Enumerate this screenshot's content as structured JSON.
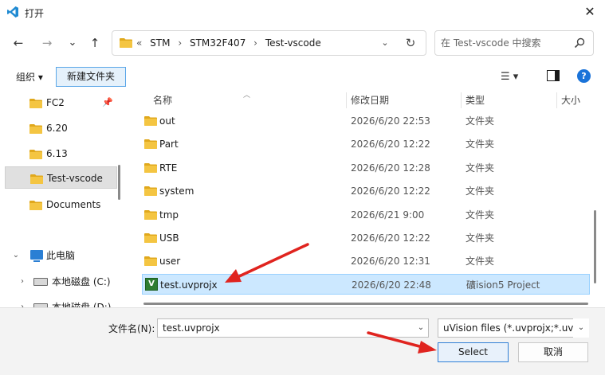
{
  "window": {
    "title": "打开",
    "close_glyph": "✕"
  },
  "nav": {
    "back_glyph": "←",
    "forward_glyph": "→",
    "recent_glyph": "⌄",
    "up_glyph": "↑",
    "breadcrumb_lead": "«",
    "breadcrumbs": [
      "STM",
      "STM32F407",
      "Test-vscode"
    ],
    "breadcrumb_sep": "›",
    "dropdown_glyph": "⌄",
    "refresh_glyph": "↻",
    "search_placeholder": "在 Test-vscode 中搜索"
  },
  "toolbar": {
    "organize_label": "组织 ▾",
    "new_folder_label": "新建文件夹",
    "view_glyph": "☰ ▾",
    "help_glyph": "?"
  },
  "sidebar": {
    "pin_glyph": "📌",
    "items": [
      {
        "label": "FC2",
        "pinned": true
      },
      {
        "label": "6.20"
      },
      {
        "label": "6.13"
      },
      {
        "label": "Test-vscode",
        "selected": true
      },
      {
        "label": "Documents"
      }
    ],
    "this_pc": {
      "label": "此电脑",
      "expander": "⌄"
    },
    "drives": [
      {
        "label": "本地磁盘 (C:)",
        "expander": "›"
      },
      {
        "label": "本地磁盘 (D:)",
        "expander": "›"
      }
    ]
  },
  "columns": {
    "name": "名称",
    "date": "修改日期",
    "type": "类型",
    "size": "大小",
    "sort_glyph": "︿"
  },
  "files": [
    {
      "name": "out",
      "date": "2026/6/20 22:53",
      "type": "文件夹",
      "kind": "folder"
    },
    {
      "name": "Part",
      "date": "2026/6/20 12:22",
      "type": "文件夹",
      "kind": "folder"
    },
    {
      "name": "RTE",
      "date": "2026/6/20 12:28",
      "type": "文件夹",
      "kind": "folder"
    },
    {
      "name": "system",
      "date": "2026/6/20 12:22",
      "type": "文件夹",
      "kind": "folder"
    },
    {
      "name": "tmp",
      "date": "2026/6/21 9:00",
      "type": "文件夹",
      "kind": "folder"
    },
    {
      "name": "USB",
      "date": "2026/6/20 12:22",
      "type": "文件夹",
      "kind": "folder"
    },
    {
      "name": "user",
      "date": "2026/6/20 12:31",
      "type": "文件夹",
      "kind": "folder"
    },
    {
      "name": "test.uvprojx",
      "date": "2026/6/20 22:48",
      "type": "礦ision5 Project",
      "kind": "uvproj",
      "selected": true,
      "icon_glyph": "V"
    }
  ],
  "footer": {
    "filename_label": "文件名(N):",
    "filename_value": "test.uvprojx",
    "filetype_value": "uVision files (*.uvprojx;*.uvm",
    "select_label": "Select",
    "cancel_label": "取消",
    "drop_glyph": "⌄"
  },
  "colors": {
    "folder": "#f4c542",
    "folder_dark": "#e0a81c",
    "selection": "#cce8ff",
    "accent_border": "#2f7fd6",
    "arrow": "#e0241f"
  }
}
